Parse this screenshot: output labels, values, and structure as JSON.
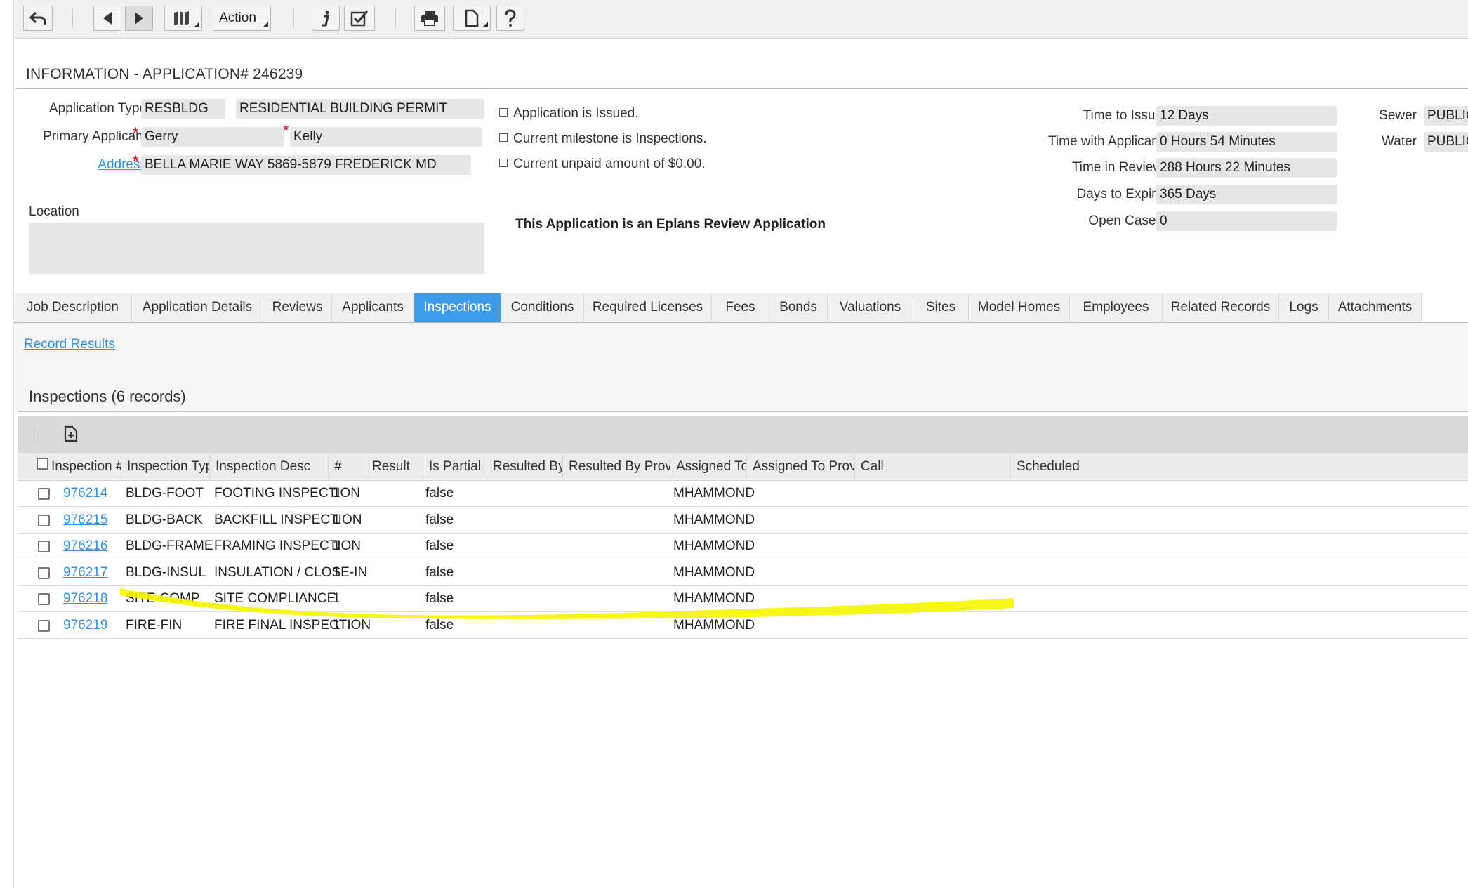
{
  "toolbar": {
    "action_label": "Action",
    "icons": [
      "undo-icon",
      "prev-arrow-icon",
      "next-arrow-icon",
      "map-icon",
      "info-icon",
      "checklist-icon",
      "print-icon",
      "document-icon",
      "help-icon"
    ]
  },
  "header": {
    "title": "INFORMATION - APPLICATION# 246239"
  },
  "fields": {
    "application_type_label": "Application Type",
    "application_type_code": "RESBLDG",
    "application_type_desc": "RESIDENTIAL BUILDING PERMIT",
    "primary_applicant_label": "Primary Applicant",
    "primary_applicant_first": "Gerry",
    "primary_applicant_last": "Kelly",
    "address_label": "Address",
    "address_value": "BELLA MARIE WAY 5869-5879 FREDERICK MD",
    "location_label": "Location",
    "location_value": ""
  },
  "status": {
    "issued": "Application is Issued.",
    "milestone": "Current milestone is Inspections.",
    "unpaid": "Current unpaid amount of $0.00.",
    "eplans": "This Application is an Eplans Review Application"
  },
  "metrics": {
    "time_to_issue_label": "Time to Issue",
    "time_to_issue": "12 Days",
    "time_with_applicant_label": "Time with Applicant",
    "time_with_applicant": "0 Hours 54 Minutes",
    "time_in_review_label": "Time in Review",
    "time_in_review": "288 Hours 22 Minutes",
    "days_to_expiry_label": "Days to Expiry",
    "days_to_expiry": "365 Days",
    "open_cases_label": "Open Cases",
    "open_cases": "0",
    "sewer_label": "Sewer",
    "sewer": "PUBLIC",
    "water_label": "Water",
    "water": "PUBLIC"
  },
  "tabs": [
    "Job Description",
    "Application Details",
    "Reviews",
    "Applicants",
    "Inspections",
    "Conditions",
    "Required Licenses",
    "Fees",
    "Bonds",
    "Valuations",
    "Sites",
    "Model Homes",
    "Employees",
    "Related Records",
    "Logs",
    "Attachments"
  ],
  "active_tab": "Inspections",
  "record_results": "Record Results",
  "inspections": {
    "title": "Inspections (6 records)",
    "columns": [
      "Inspection #",
      "Inspection Type",
      "Inspection Desc",
      "#",
      "Result",
      "Is Partial",
      "Resulted By",
      "Resulted By Provider",
      "Assigned To",
      "Assigned To Provider",
      "Call",
      "Scheduled"
    ],
    "rows": [
      {
        "id": "976214",
        "type": "BLDG-FOOT",
        "desc": "FOOTING INSPECTION",
        "num": "1",
        "result": "",
        "partial": "false",
        "resulted_by": "",
        "provider": "",
        "assigned": "MHAMMOND"
      },
      {
        "id": "976215",
        "type": "BLDG-BACK",
        "desc": "BACKFILL INSPECTION",
        "num": "1",
        "result": "",
        "partial": "false",
        "resulted_by": "",
        "provider": "",
        "assigned": "MHAMMOND"
      },
      {
        "id": "976216",
        "type": "BLDG-FRAME",
        "desc": "FRAMING INSPECTION",
        "num": "1",
        "result": "",
        "partial": "false",
        "resulted_by": "",
        "provider": "",
        "assigned": "MHAMMOND"
      },
      {
        "id": "976217",
        "type": "BLDG-INSUL",
        "desc": "INSULATION / CLOSE-IN",
        "num": "1",
        "result": "",
        "partial": "false",
        "resulted_by": "",
        "provider": "",
        "assigned": "MHAMMOND"
      },
      {
        "id": "976218",
        "type": "SITE-COMP",
        "desc": "SITE COMPLIANCE",
        "num": "1",
        "result": "",
        "partial": "false",
        "resulted_by": "",
        "provider": "",
        "assigned": "MHAMMOND"
      },
      {
        "id": "976219",
        "type": "FIRE-FIN",
        "desc": "FIRE FINAL INSPECTION",
        "num": "1",
        "result": "",
        "partial": "false",
        "resulted_by": "",
        "provider": "",
        "assigned": "MHAMMOND"
      }
    ]
  },
  "colors": {
    "accent": "#3d9be9",
    "highlight": "#f5f500",
    "required": "#d0021b",
    "link": "#3a8fd8"
  }
}
